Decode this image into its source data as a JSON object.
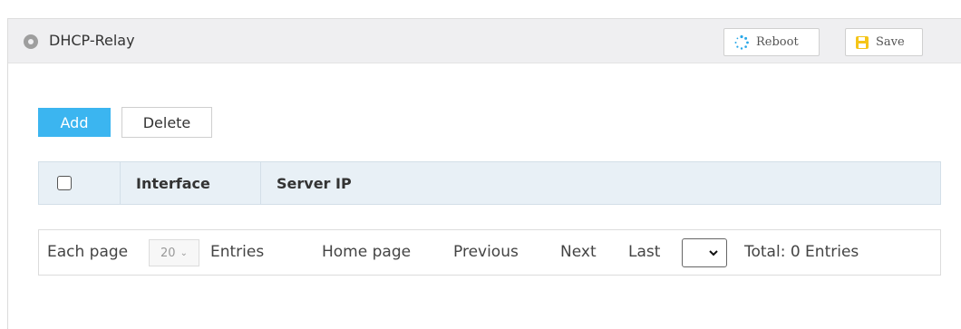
{
  "header": {
    "title": "DHCP-Relay",
    "reboot_label": "Reboot",
    "save_label": "Save"
  },
  "toolbar": {
    "add_label": "Add",
    "delete_label": "Delete"
  },
  "table": {
    "columns": [
      "Interface",
      "Server IP"
    ],
    "rows": []
  },
  "pager": {
    "each_page_label": "Each page",
    "page_size": "20",
    "entries_label": "Entries",
    "home_label": "Home page",
    "previous_label": "Previous",
    "next_label": "Next",
    "last_label": "Last",
    "page_select_value": "",
    "total_label": "Total: 0 Entries"
  },
  "colors": {
    "accent": "#3bb5f0",
    "header_bg": "#efeff1",
    "table_head_bg": "#e8f0f6",
    "save_icon": "#f5c518",
    "reboot_icon": "#2aa8e8"
  },
  "icons": {
    "title": "circle-dot-icon",
    "reboot": "spinner-icon",
    "save": "floppy-disk-icon",
    "page_size": "chevron-down-icon",
    "page_select": "chevron-down-icon"
  }
}
